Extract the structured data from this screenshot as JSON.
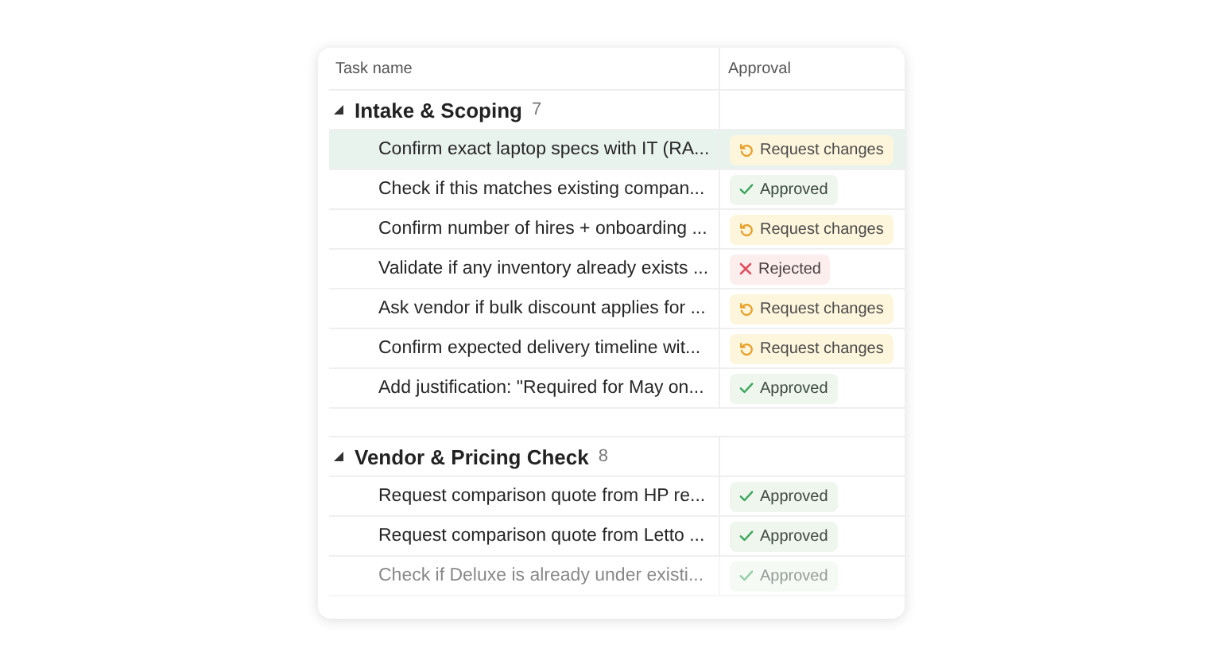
{
  "table": {
    "columns": [
      "Task name",
      "Approval"
    ],
    "groups": [
      {
        "title": "Intake & Scoping",
        "count": "7",
        "expanded": true,
        "rows": [
          {
            "task": "Confirm exact laptop specs with IT (RA...",
            "selected": true,
            "approval": {
              "kind": "request_changes",
              "label": "Request changes"
            }
          },
          {
            "task": "Check if this matches existing compan...",
            "selected": false,
            "approval": {
              "kind": "approved",
              "label": "Approved"
            }
          },
          {
            "task": "Confirm number of hires + onboarding ...",
            "selected": false,
            "approval": {
              "kind": "request_changes",
              "label": "Request changes"
            }
          },
          {
            "task": "Validate if any inventory already exists ...",
            "selected": false,
            "approval": {
              "kind": "rejected",
              "label": "Rejected"
            }
          },
          {
            "task": "Ask vendor if bulk discount applies for ...",
            "selected": false,
            "approval": {
              "kind": "request_changes",
              "label": "Request changes"
            }
          },
          {
            "task": "Confirm expected delivery timeline wit...",
            "selected": false,
            "approval": {
              "kind": "request_changes",
              "label": "Request changes"
            }
          },
          {
            "task": "Add justification: \"Required for May on...",
            "selected": false,
            "approval": {
              "kind": "approved",
              "label": "Approved"
            }
          }
        ]
      },
      {
        "title": "Vendor & Pricing Check",
        "count": "8",
        "expanded": true,
        "rows": [
          {
            "task": "Request comparison quote from HP re...",
            "selected": false,
            "approval": {
              "kind": "approved",
              "label": "Approved"
            }
          },
          {
            "task": "Request comparison quote from Letto ...",
            "selected": false,
            "approval": {
              "kind": "approved",
              "label": "Approved"
            }
          },
          {
            "task": "Check if Deluxe is already under existi...",
            "selected": false,
            "approval": {
              "kind": "approved",
              "label": "Approved"
            }
          }
        ]
      }
    ]
  }
}
